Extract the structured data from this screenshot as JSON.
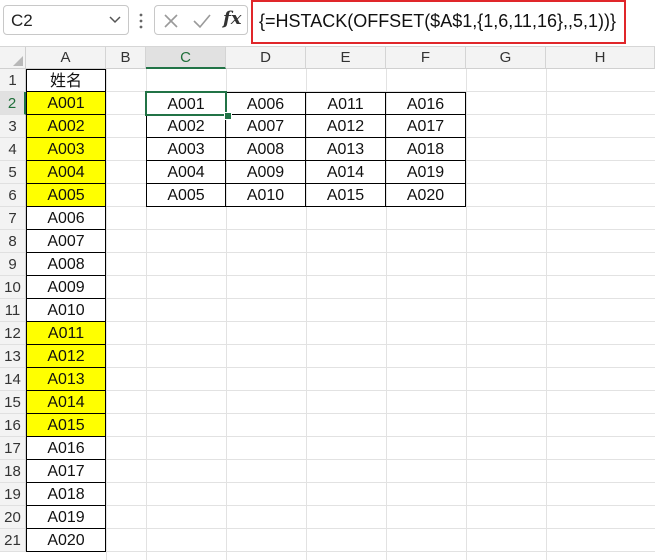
{
  "formula_bar": {
    "name_box": "C2",
    "fx_label": "fx",
    "formula": "{=HSTACK(OFFSET($A$1,{1,6,11,16},,5,1))}"
  },
  "columns": [
    "A",
    "B",
    "C",
    "D",
    "E",
    "F",
    "G",
    "H"
  ],
  "rows": [
    "1",
    "2",
    "3",
    "4",
    "5",
    "6",
    "7",
    "8",
    "9",
    "10",
    "11",
    "12",
    "13",
    "14",
    "15",
    "16",
    "17",
    "18",
    "19",
    "20",
    "21"
  ],
  "column_a": {
    "header": "姓名",
    "values": [
      "A001",
      "A002",
      "A003",
      "A004",
      "A005",
      "A006",
      "A007",
      "A008",
      "A009",
      "A010",
      "A011",
      "A012",
      "A013",
      "A014",
      "A015",
      "A016",
      "A017",
      "A018",
      "A019",
      "A020"
    ],
    "highlighted": [
      true,
      true,
      true,
      true,
      true,
      false,
      false,
      false,
      false,
      false,
      true,
      true,
      true,
      true,
      true,
      false,
      false,
      false,
      false,
      false
    ],
    "highlight_color": "#ffff00"
  },
  "result_table": [
    [
      "A001",
      "A006",
      "A011",
      "A016"
    ],
    [
      "A002",
      "A007",
      "A012",
      "A017"
    ],
    [
      "A003",
      "A008",
      "A013",
      "A018"
    ],
    [
      "A004",
      "A009",
      "A014",
      "A019"
    ],
    [
      "A005",
      "A010",
      "A015",
      "A020"
    ]
  ],
  "active_cell": "C2",
  "accent_color": "#217346",
  "formula_highlight_color": "#e0262a"
}
